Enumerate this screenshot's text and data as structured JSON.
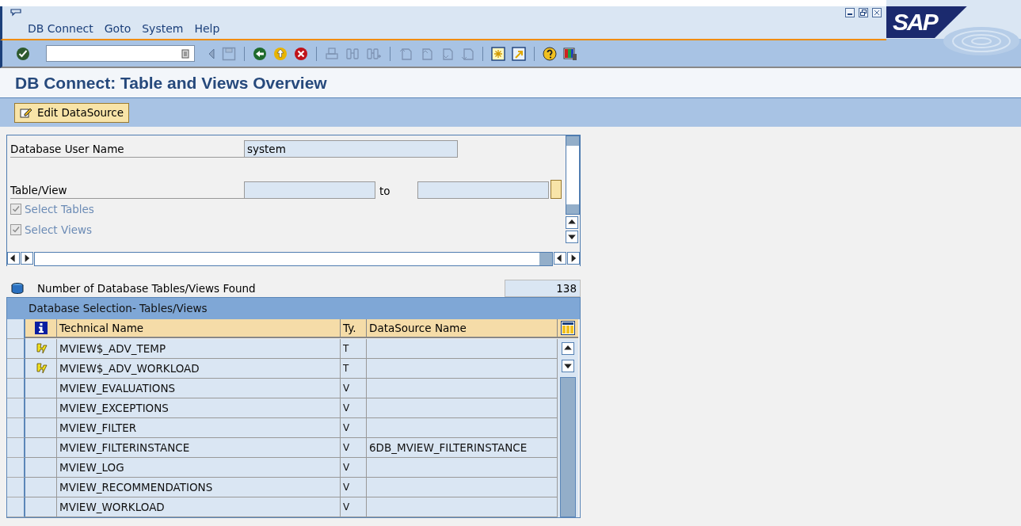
{
  "window": {
    "logo": "SAP"
  },
  "menu": [
    {
      "label": "DB Connect"
    },
    {
      "label": "Goto"
    },
    {
      "label": "System"
    },
    {
      "label": "Help"
    }
  ],
  "title": "DB Connect: Table and Views Overview",
  "app_toolbar": {
    "button": "Edit DataSource"
  },
  "selection": {
    "user_label": "Database User Name",
    "user_value": "system",
    "table_label": "Table/View",
    "to_label": "to",
    "checkboxes": [
      {
        "label": "Select Tables",
        "checked": true,
        "disabled": true
      },
      {
        "label": "Select Views",
        "checked": true,
        "disabled": true
      }
    ]
  },
  "count": {
    "label": "Number of Database Tables/Views Found",
    "value": "138"
  },
  "table": {
    "title": "Database Selection- Tables/Views",
    "columns": [
      "Technical Name",
      "Ty.",
      "DataSource Name"
    ],
    "rows": [
      {
        "name": "MVIEW$_ADV_TEMP",
        "type": "T",
        "datasource": "",
        "flagged": true
      },
      {
        "name": "MVIEW$_ADV_WORKLOAD",
        "type": "T",
        "datasource": "",
        "flagged": true
      },
      {
        "name": "MVIEW_EVALUATIONS",
        "type": "V",
        "datasource": "",
        "flagged": false
      },
      {
        "name": "MVIEW_EXCEPTIONS",
        "type": "V",
        "datasource": "",
        "flagged": false
      },
      {
        "name": "MVIEW_FILTER",
        "type": "V",
        "datasource": "",
        "flagged": false
      },
      {
        "name": "MVIEW_FILTERINSTANCE",
        "type": "V",
        "datasource": "6DB_MVIEW_FILTERINSTANCE",
        "flagged": false
      },
      {
        "name": "MVIEW_LOG",
        "type": "V",
        "datasource": "",
        "flagged": false
      },
      {
        "name": "MVIEW_RECOMMENDATIONS",
        "type": "V",
        "datasource": "",
        "flagged": false
      },
      {
        "name": "MVIEW_WORKLOAD",
        "type": "V",
        "datasource": "",
        "flagged": false
      }
    ]
  }
}
